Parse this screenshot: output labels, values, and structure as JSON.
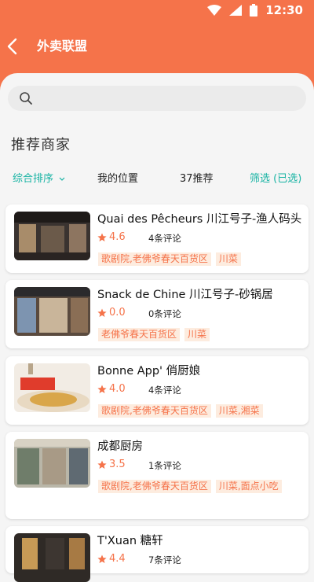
{
  "status": {
    "time": "12:30"
  },
  "header": {
    "title": "外卖联盟"
  },
  "search": {
    "placeholder": ""
  },
  "section": {
    "title": "推荐商家"
  },
  "filters": {
    "sort": "综合排序",
    "location": "我的位置",
    "recommend": "37推荐",
    "filter": "筛选 (已选)"
  },
  "colors": {
    "accent": "#f5734a",
    "teal": "#17b3a3",
    "tag_bg": "#fdecdf"
  },
  "restaurants": [
    {
      "name": "Quai des Pêcheurs 川江号子-渔人码头",
      "rating": "4.6",
      "reviews": "4条评论",
      "tags": [
        "歌剧院,老佛爷春天百货区",
        "川菜"
      ]
    },
    {
      "name": "Snack de Chine 川江号子-砂锅居",
      "rating": "0.0",
      "reviews": "0条评论",
      "tags": [
        "老佛爷春天百货区",
        "川菜"
      ]
    },
    {
      "name": "Bonne App' 俏厨娘",
      "rating": "4.0",
      "reviews": "4条评论",
      "tags": [
        "歌剧院,老佛爷春天百货区",
        "川菜,湘菜"
      ]
    },
    {
      "name": "成都厨房",
      "rating": "3.5",
      "reviews": "1条评论",
      "tags": [
        "歌剧院,老佛爷春天百货区",
        "川菜,面点小吃"
      ]
    },
    {
      "name": "T'Xuan 糖轩",
      "rating": "4.4",
      "reviews": "7条评论",
      "tags": []
    }
  ]
}
